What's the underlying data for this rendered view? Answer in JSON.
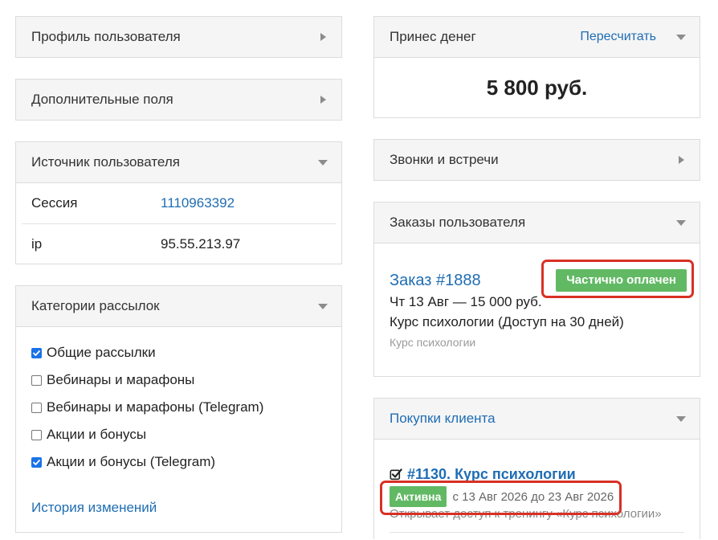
{
  "left": {
    "profile": {
      "title": "Профиль пользователя"
    },
    "extra_fields": {
      "title": "Дополнительные поля"
    },
    "source": {
      "title": "Источник пользователя",
      "rows": [
        {
          "label": "Сессия",
          "value": "1110963392"
        },
        {
          "label": "ip",
          "value": "95.55.213.97"
        }
      ]
    },
    "categories": {
      "title": "Категории рассылок",
      "items": [
        {
          "label": "Общие рассылки",
          "checked": true
        },
        {
          "label": "Вебинары и марафоны",
          "checked": false
        },
        {
          "label": "Вебинары и марафоны (Telegram)",
          "checked": false
        },
        {
          "label": "Акции и бонусы",
          "checked": false
        },
        {
          "label": "Акции и бонусы (Telegram)",
          "checked": true
        }
      ],
      "history_link": "История изменений"
    }
  },
  "right": {
    "money": {
      "title": "Принес денег",
      "recalc_link": "Пересчитать",
      "amount": "5 800 руб."
    },
    "calls": {
      "title": "Звонки и встречи"
    },
    "orders": {
      "title": "Заказы пользователя",
      "items": [
        {
          "number": "Заказ #1888",
          "status": "Частично оплачен",
          "date_sum": "Чт 13 Авг — 15 000 руб.",
          "product": "Курс психологии (Доступ на 30 дней)",
          "category": "Курс психологии"
        }
      ]
    },
    "purchases": {
      "title": "Покупки клиента",
      "items": [
        {
          "name": "#1130. Курс психологии",
          "status": "Активна",
          "period": "с 13 Авг 2026 до 23 Авг 2026",
          "description": "Открывает доступ к тренингу «Курс психологии»"
        }
      ]
    }
  },
  "icons": {
    "collapsed_panel": "chevron-right-icon",
    "expanded_panel": "chevron-down-icon",
    "purchase": "checkbox-checked-icon"
  },
  "colors": {
    "link": "#1f6db3",
    "status_green": "#62b964",
    "annotation_red": "#d93025",
    "header_bg": "#f5f5f5",
    "border": "#dcdcdc",
    "checkbox_blue": "#1a73e8"
  }
}
